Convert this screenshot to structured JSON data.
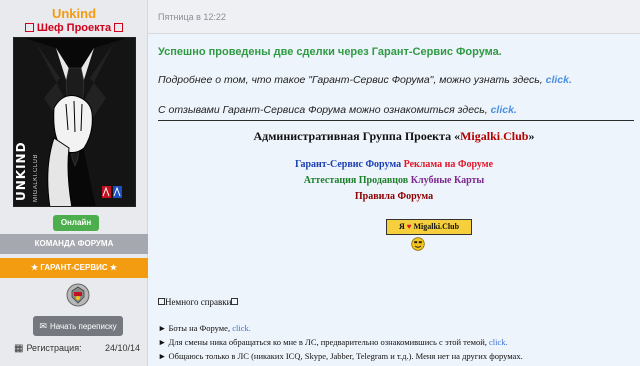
{
  "profile": {
    "username": "Unkind",
    "rank": "Шеф Проекта",
    "avatar_name": "UNKIND",
    "avatar_sub": "MIGALKI.CLUB",
    "online_status": "Онлайн",
    "group": "КОМАНДА ФОРУМА",
    "garant": "★ ГАРАНТ-СЕРВИС ★",
    "pm_label": "Начать переписку",
    "registration_label": "Регистрация:",
    "registration_date": "24/10/14"
  },
  "post": {
    "date": "Пятница в 12:22",
    "success_line": "Успешно проведены две сделки через Гарант-Сервис Форума.",
    "info_line": "Подробнее о том, что такое \"Гарант-Сервис Форума\", можно узнать здесь,",
    "reviews_line": "С отзывами Гарант-Сервиса Форума можно ознакомиться здесь,",
    "click": "click."
  },
  "signature": {
    "admin_prefix": "Административная Группа Проекта «",
    "site_a": "Migalki",
    "site_b": ".",
    "site_c": "Club",
    "admin_suffix": "»",
    "links_row1": [
      "Гарант-Сервис Форума",
      "Реклама на Форуме"
    ],
    "links_row2": [
      "Аттестация Продавцов",
      "Клубные Карты"
    ],
    "links_row3": [
      "Правила Форума"
    ],
    "banner_pre": "Я",
    "banner_post": "Migalki.Club",
    "help_title": "Немного справки",
    "bullets": [
      {
        "text": "► Боты на Форуме, ",
        "link": "click."
      },
      {
        "text": "► Для смены ника обращаться ко мне в ЛС, предварительно ознакомившись с этой темой, ",
        "link": "click."
      },
      {
        "text": "► Общаюсь только в ЛС (никаких ICQ, Skype, Jabber, Telegram и т.д.). Меня нет на других форумах.",
        "link": ""
      }
    ]
  },
  "icons": {
    "avatar": "suited-man-avatar",
    "badge": "garant-badge-icon",
    "pm": "envelope-icon",
    "calendar": "calendar-icon",
    "heart": "heart-icon",
    "smiley": "smiley-icon"
  },
  "colors": {
    "username": "#f39c12",
    "rank": "#d0021b",
    "online": "#4cae4c",
    "garant_bar": "#f39c12",
    "success": "#2f9a44",
    "link": "#4a90e2"
  }
}
